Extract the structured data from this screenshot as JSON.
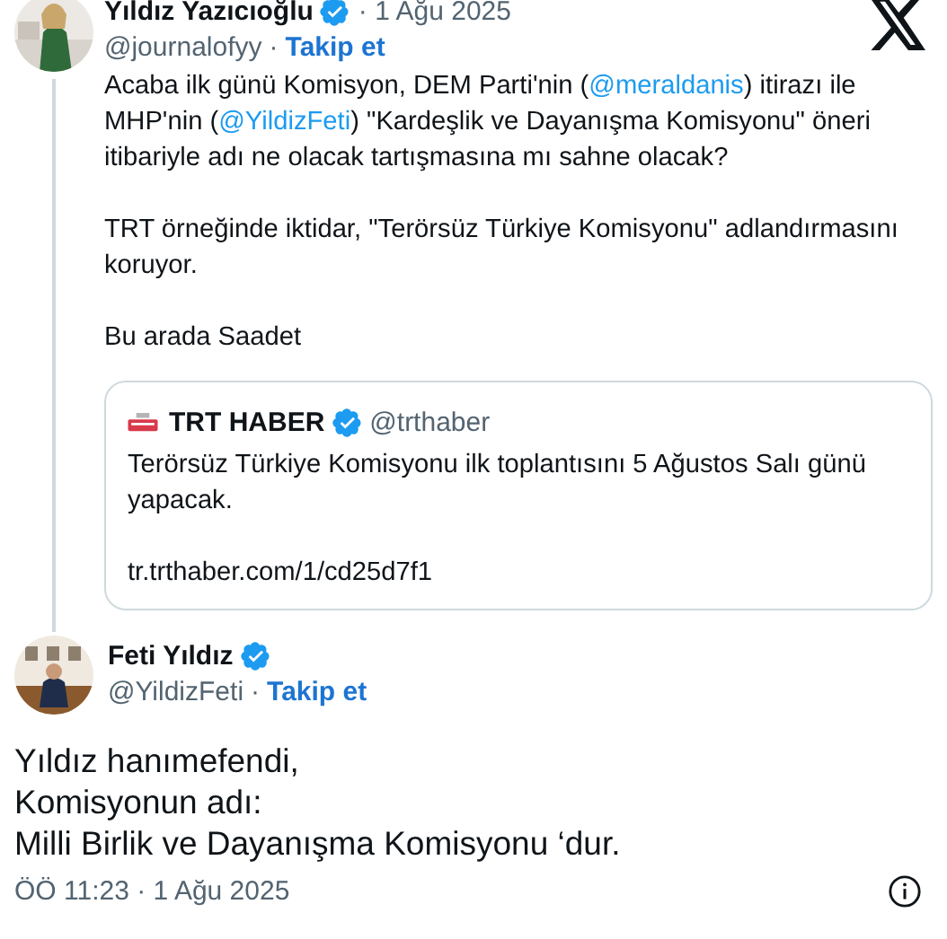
{
  "quoted_tweet": {
    "author": {
      "name": "Yıldız Yazıcıoğlu",
      "verified": true,
      "date": "· 1 Ağu 2025",
      "handle": "@journalofyy",
      "separator": "·",
      "follow": "Takip et"
    },
    "paragraphs": [
      [
        {
          "kind": "text",
          "text": "Acaba ilk günü Komisyon, DEM Parti'nin ("
        },
        {
          "kind": "mention",
          "text": "@meraldanis"
        },
        {
          "kind": "text",
          "text": ") itirazı ile MHP'nin ("
        },
        {
          "kind": "mention",
          "text": "@YildizFeti"
        },
        {
          "kind": "text",
          "text": ") \"Kardeşlik ve Dayanışma Komisyonu\" öneri itibariyle adı ne olacak tartışmasına mı sahne olacak?"
        }
      ],
      [
        {
          "kind": "text",
          "text": "TRT örneğinde iktidar, \"Terörsüz Türkiye Komisyonu\" adlandırmasını koruyor."
        }
      ],
      [
        {
          "kind": "text",
          "text": "Bu arada Saadet"
        }
      ]
    ],
    "embedded": {
      "name": "TRT HABER",
      "verified": true,
      "handle": "@trthaber",
      "text": "Terörsüz Türkiye Komisyonu ilk toplantısını 5 Ağustos Salı günü yapacak.",
      "link": "tr.trthaber.com/1/cd25d7f1"
    }
  },
  "tweet": {
    "author": {
      "name": "Feti Yıldız",
      "verified": true,
      "handle": "@YildizFeti",
      "separator": "·",
      "follow": "Takip et"
    },
    "text": "Yıldız hanımefendi,\nKomisyonun adı:\nMilli Birlik ve Dayanışma Komisyonu ‘dur.",
    "timestamp": "ÖÖ 11:23 · 1 Ağu 2025"
  }
}
